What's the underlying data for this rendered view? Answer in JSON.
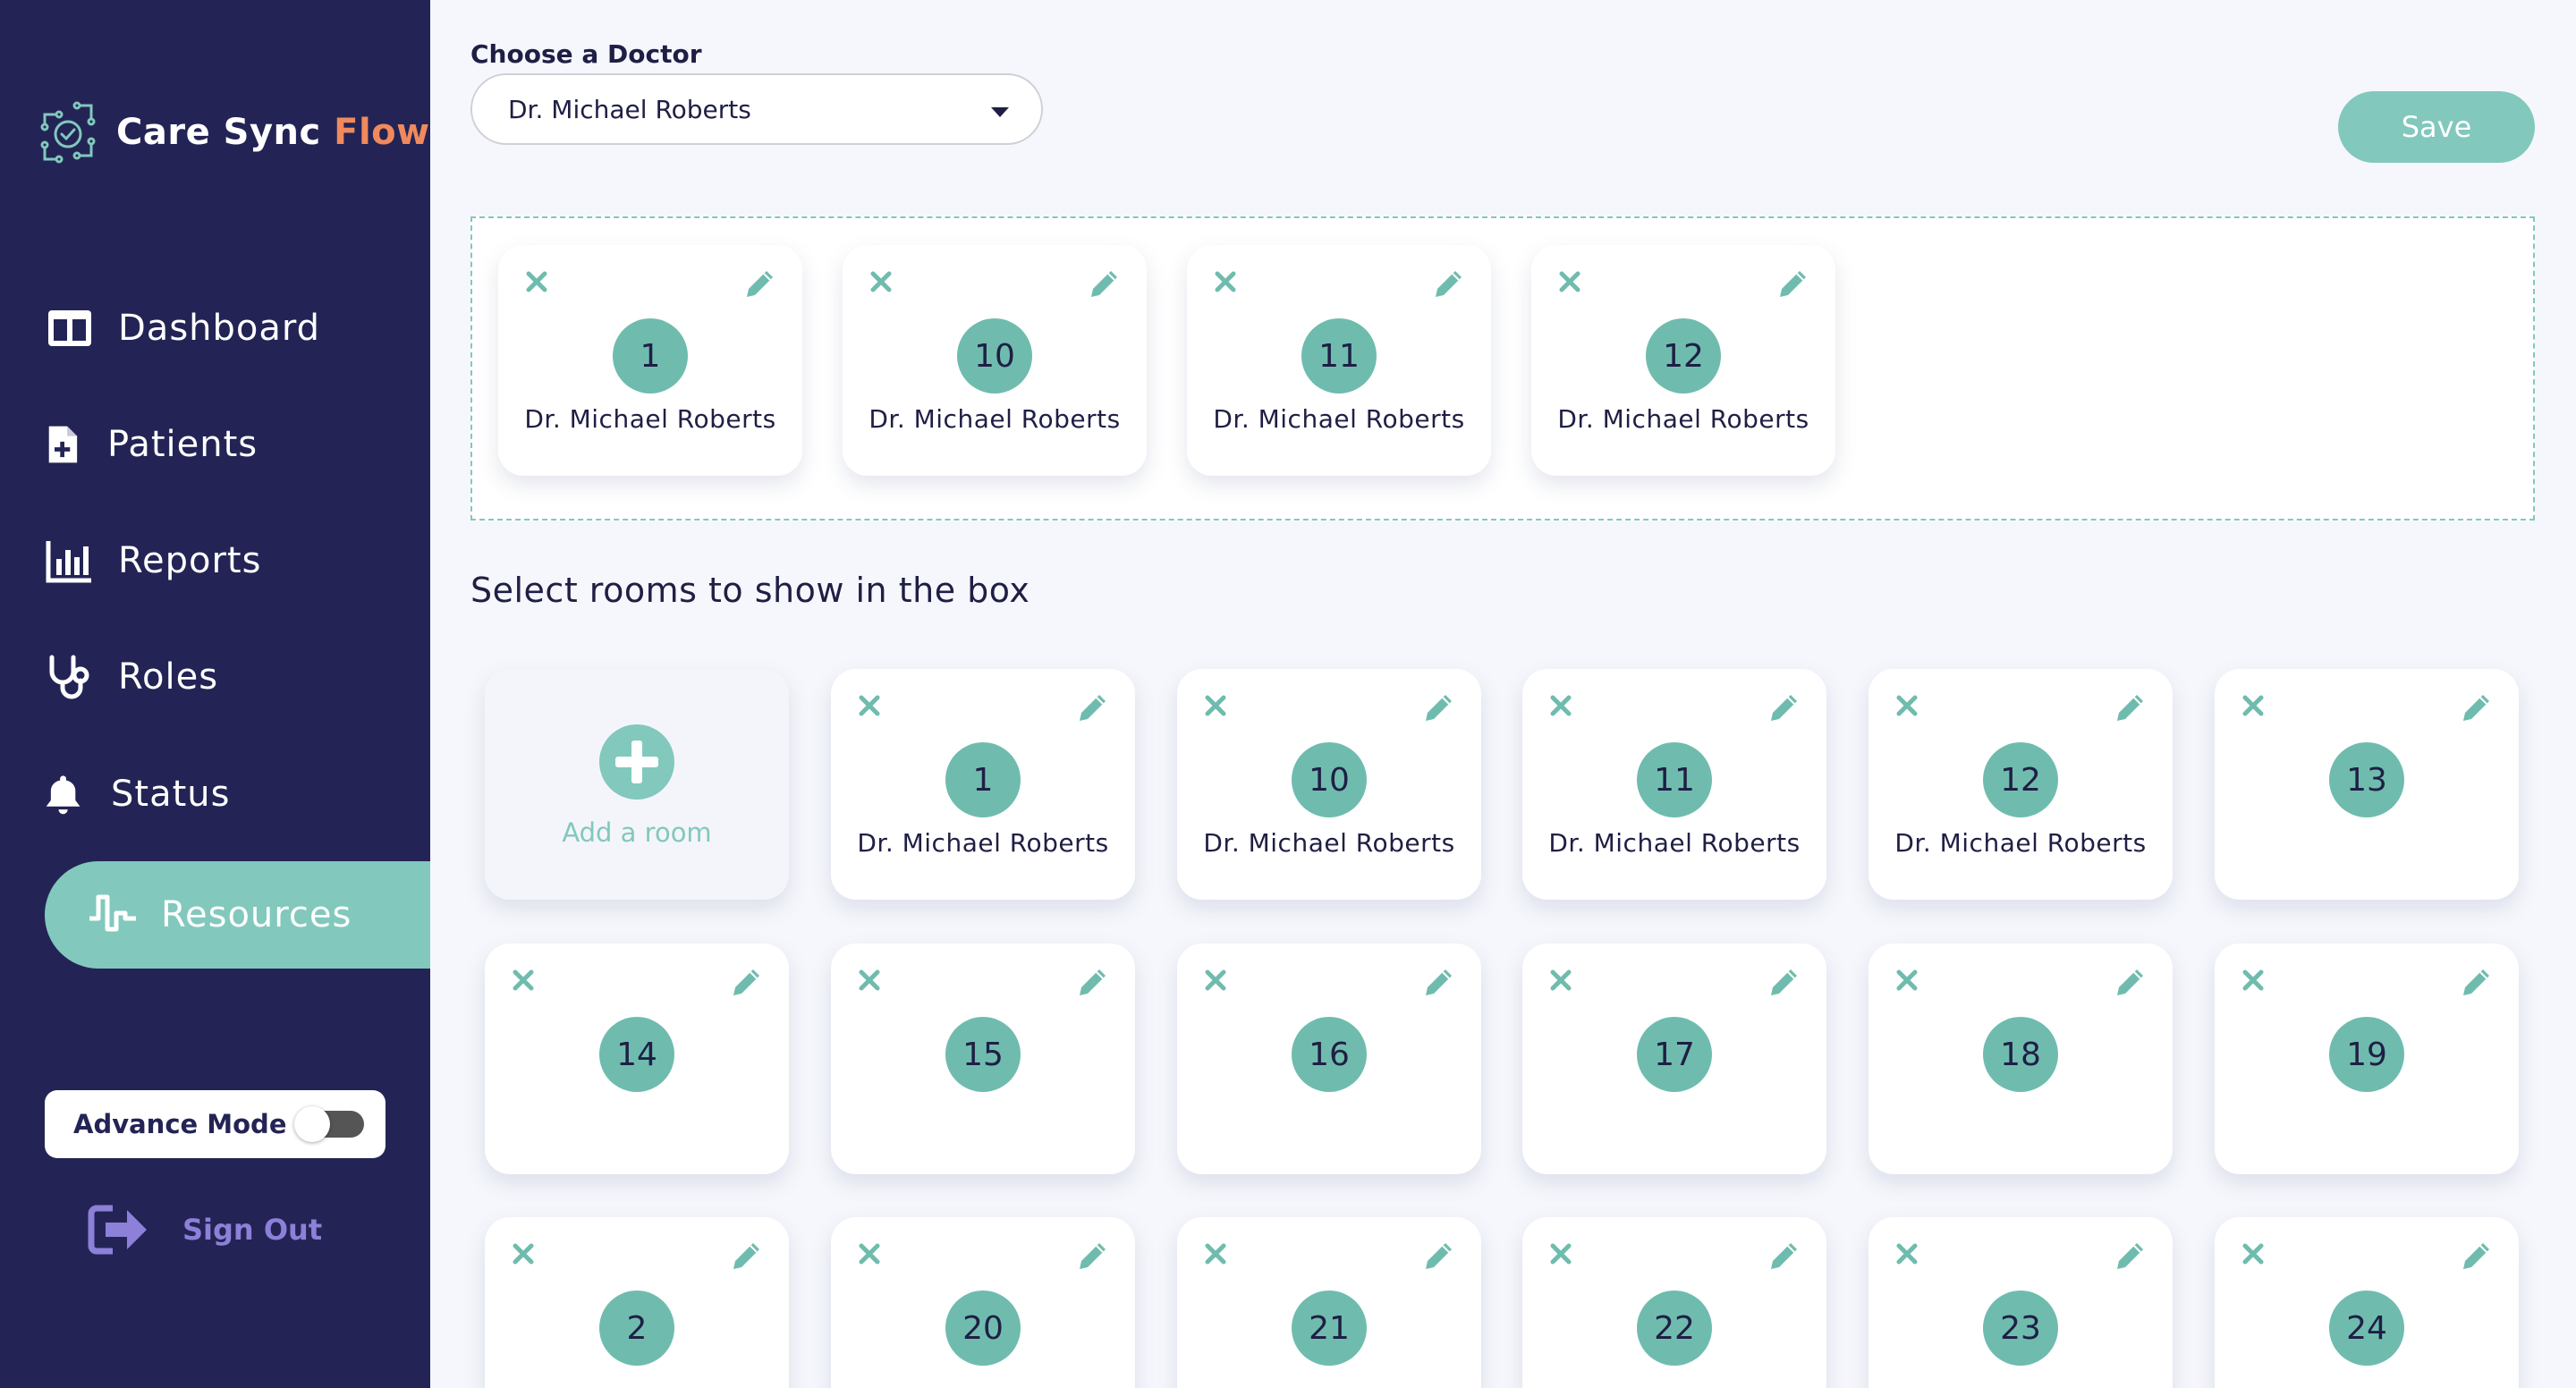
{
  "app": {
    "name_main": "Care Sync",
    "name_accent": "Flow",
    "logo_icon": "care-sync-logo",
    "accent_color": "#82c8bd",
    "brand_color": "#f08a5d",
    "sidebar_color": "#232455"
  },
  "nav": {
    "items": [
      {
        "label": "Dashboard",
        "icon": "dashboard-icon",
        "active": false
      },
      {
        "label": "Patients",
        "icon": "patient-file-icon",
        "active": false
      },
      {
        "label": "Reports",
        "icon": "bar-chart-icon",
        "active": false
      },
      {
        "label": "Roles",
        "icon": "stethoscope-icon",
        "active": false
      },
      {
        "label": "Status",
        "icon": "bell-icon",
        "active": false
      },
      {
        "label": "Resources",
        "icon": "pulse-icon",
        "active": true
      }
    ]
  },
  "advance_mode": {
    "label": "Advance Mode",
    "enabled": false
  },
  "sign_out": {
    "label": "Sign Out",
    "icon": "sign-out-icon"
  },
  "doctor_picker": {
    "label": "Choose a Doctor",
    "selected": "Dr. Michael Roberts"
  },
  "save_label": "Save",
  "box_rooms": [
    {
      "number": "1",
      "doctor": "Dr. Michael Roberts"
    },
    {
      "number": "10",
      "doctor": "Dr. Michael Roberts"
    },
    {
      "number": "11",
      "doctor": "Dr. Michael Roberts"
    },
    {
      "number": "12",
      "doctor": "Dr. Michael Roberts"
    }
  ],
  "rooms_section": {
    "title": "Select rooms to show in the box",
    "add_label": "Add a room"
  },
  "rooms": [
    {
      "number": "1",
      "doctor": "Dr. Michael Roberts"
    },
    {
      "number": "10",
      "doctor": "Dr. Michael Roberts"
    },
    {
      "number": "11",
      "doctor": "Dr. Michael Roberts"
    },
    {
      "number": "12",
      "doctor": "Dr. Michael Roberts"
    },
    {
      "number": "13",
      "doctor": ""
    },
    {
      "number": "14",
      "doctor": ""
    },
    {
      "number": "15",
      "doctor": ""
    },
    {
      "number": "16",
      "doctor": ""
    },
    {
      "number": "17",
      "doctor": ""
    },
    {
      "number": "18",
      "doctor": ""
    },
    {
      "number": "19",
      "doctor": ""
    },
    {
      "number": "2",
      "doctor": ""
    },
    {
      "number": "20",
      "doctor": ""
    },
    {
      "number": "21",
      "doctor": ""
    },
    {
      "number": "22",
      "doctor": ""
    },
    {
      "number": "23",
      "doctor": ""
    },
    {
      "number": "24",
      "doctor": ""
    }
  ]
}
